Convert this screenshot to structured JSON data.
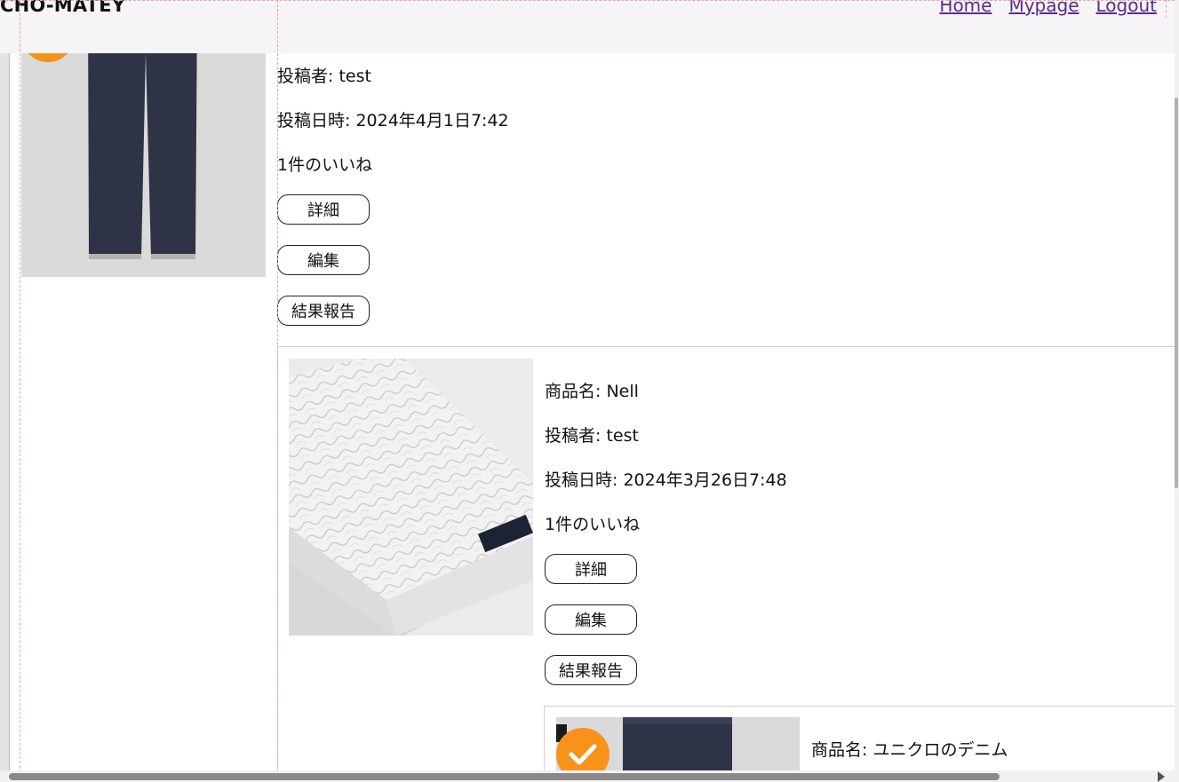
{
  "header": {
    "brand": "CHO-MATEY",
    "nav": [
      "Home",
      "Mypage",
      "Logout"
    ]
  },
  "posts": [
    {
      "author_line": "投稿者: test",
      "date_line": "投稿日時: 2024年4月1日7:42",
      "likes_line": "1件のいいね",
      "buttons": [
        "詳細",
        "編集",
        "結果報告"
      ]
    },
    {
      "name_line": "商品名: Nell",
      "author_line": "投稿者: test",
      "date_line": "投稿日時: 2024年3月26日7:48",
      "likes_line": "1件のいいね",
      "buttons": [
        "詳細",
        "編集",
        "結果報告"
      ]
    },
    {
      "name_line": "商品名: ユニクロのデニム"
    }
  ],
  "colors": {
    "badge": "#f7931b",
    "nav_link": "#5a2c8e",
    "navbar_bg": "#f6f4f6"
  },
  "icons": [
    "check-icon"
  ]
}
